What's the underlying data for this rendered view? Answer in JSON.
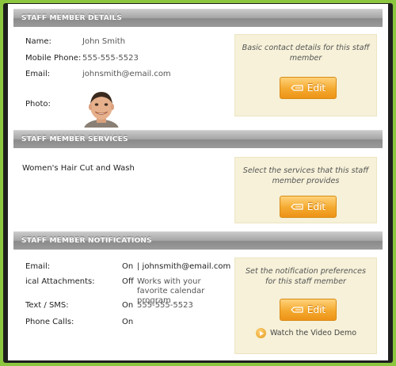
{
  "sections": {
    "details": {
      "title": "STAFF MEMBER DETAILS",
      "fields": {
        "name_label": "Name:",
        "name_value": "John Smith",
        "mobile_label": "Mobile Phone:",
        "mobile_value": "555-555-5523",
        "email_label": "Email:",
        "email_value": "johnsmith@email.com",
        "photo_label": "Photo:"
      },
      "side_text": "Basic contact details for this staff member",
      "edit_label": "Edit"
    },
    "services": {
      "title": "STAFF MEMBER SERVICES",
      "items": [
        "Women's Hair Cut and Wash"
      ],
      "side_text": "Select the services that this staff member provides",
      "edit_label": "Edit"
    },
    "notifications": {
      "title": "STAFF MEMBER NOTIFICATIONS",
      "rows": [
        {
          "label": "Email:",
          "status": "On",
          "detail": "| johnsmith@email.com"
        },
        {
          "label": "ical Attachments:",
          "status": "Off",
          "detail": "Works with your favorite calendar program"
        },
        {
          "label": "Text / SMS:",
          "status": "On",
          "detail": "555-555-5523"
        },
        {
          "label": "Phone Calls:",
          "status": "On",
          "detail": ""
        }
      ],
      "side_text": "Set the notification preferences for this staff member",
      "edit_label": "Edit",
      "video_label": "Watch the Video Demo"
    }
  },
  "colors": {
    "outer_border": "#8cc63f",
    "frame": "#1e1e1e",
    "header_gray": "#9b9b9b",
    "side_box": "#f6f1d8",
    "button_orange": "#f4a92f"
  }
}
